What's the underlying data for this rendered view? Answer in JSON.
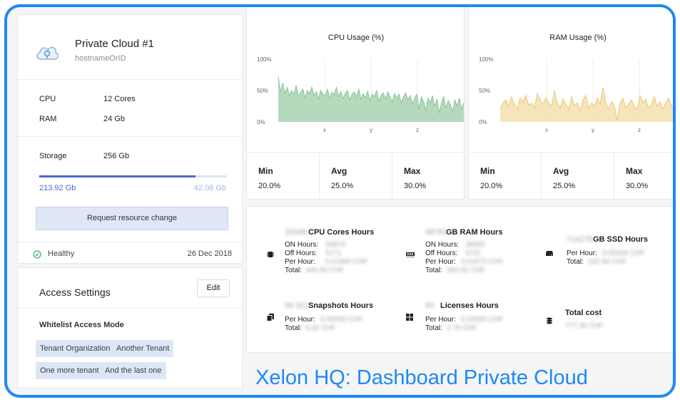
{
  "cloud": {
    "name": "Private Cloud #1",
    "hostname": "hostnameOrID",
    "specs": [
      {
        "label": "CPU",
        "value": "12 Cores"
      },
      {
        "label": "RAM",
        "value": "24 Gb"
      },
      {
        "label": "Storage",
        "value": "256 Gb"
      }
    ],
    "storage_used": "213.92 Gb",
    "storage_free": "42.08 Gb",
    "storage_used_fraction": 0.836,
    "request_button": "Request resource change",
    "status": "Healthy",
    "date": "26 Dec 2018"
  },
  "access": {
    "title": "Access Settings",
    "edit_label": "Edit",
    "mode": "Whitelist Access Mode",
    "tenants": [
      "Tenant Organization",
      "Another Tenant",
      "One more tenant",
      "And the last one"
    ]
  },
  "charts": [
    {
      "title": "CPU Usage (%)",
      "y_ticks": [
        "100%",
        "50%",
        "0%"
      ],
      "x_ticks": [
        "x",
        "y",
        "z"
      ],
      "color": "#a9d2b1",
      "line": "#8cc29a",
      "stats": [
        {
          "label": "Min",
          "value": "20.0%"
        },
        {
          "label": "Avg",
          "value": "25.0%"
        },
        {
          "label": "Max",
          "value": "30.0%"
        }
      ]
    },
    {
      "title": "RAM Usage (%)",
      "y_ticks": [
        "100%",
        "50%",
        "0%"
      ],
      "x_ticks": [
        "x",
        "y",
        "z"
      ],
      "color": "#f5e0ae",
      "line": "#ecc774",
      "stats": [
        {
          "label": "Min",
          "value": "20.0%"
        },
        {
          "label": "Avg",
          "value": "25.0%"
        },
        {
          "label": "Max",
          "value": "30.0%"
        }
      ]
    }
  ],
  "chart_data": [
    {
      "type": "area",
      "title": "CPU Usage (%)",
      "xlabel": "",
      "ylabel": "",
      "ylim": [
        0,
        100
      ],
      "x_ticks": [
        "x",
        "y",
        "z"
      ],
      "values": [
        72,
        48,
        62,
        45,
        55,
        42,
        50,
        44,
        58,
        40,
        47,
        52,
        38,
        50,
        45,
        55,
        42,
        48,
        36,
        50,
        44,
        41,
        52,
        38,
        47,
        43,
        55,
        40,
        48,
        37,
        46,
        50,
        35,
        44,
        48,
        40,
        52,
        36,
        45,
        38,
        49,
        34,
        44,
        40,
        50,
        33,
        42,
        46,
        36,
        48,
        40,
        32,
        45,
        38,
        44,
        30,
        40,
        46,
        35,
        42,
        28,
        38,
        44,
        20,
        40,
        32,
        18,
        38,
        30,
        42,
        24,
        36,
        14,
        30,
        40,
        22,
        34,
        28,
        16,
        35,
        25,
        38,
        20,
        30
      ]
    },
    {
      "type": "area",
      "title": "RAM Usage (%)",
      "xlabel": "",
      "ylabel": "",
      "ylim": [
        0,
        100
      ],
      "x_ticks": [
        "x",
        "y",
        "z"
      ],
      "values": [
        22,
        30,
        35,
        25,
        40,
        28,
        20,
        38,
        32,
        42,
        26,
        30,
        22,
        45,
        35,
        28,
        38,
        30,
        25,
        50,
        30,
        22,
        36,
        28,
        20,
        40,
        26,
        30,
        18,
        35,
        42,
        22,
        30,
        25,
        38,
        28,
        55,
        30,
        20,
        32,
        26,
        2,
        30,
        38,
        22,
        28,
        35,
        24,
        20,
        42,
        30,
        36,
        22,
        28,
        40,
        25,
        32,
        20,
        30,
        38,
        26,
        22,
        34,
        28,
        36,
        40
      ]
    }
  ],
  "usage": [
    {
      "value": "32548",
      "title": "CPU Cores Hours",
      "icon": "chip-icon",
      "rows": [
        {
          "label": "ON Hours:",
          "value": "20873"
        },
        {
          "label": "Off Hours:",
          "value": "5172"
        },
        {
          "label": "Per Hour:",
          "value": "0.01600 CHF"
        },
        {
          "label": "Total:",
          "value": "346.00 CHF"
        }
      ]
    },
    {
      "value": "48781",
      "title": "GB RAM Hours",
      "icon": "ram-icon",
      "rows": [
        {
          "label": "ON Hours:",
          "value": "38082"
        },
        {
          "label": "Off Hours:",
          "value": "9721"
        },
        {
          "label": "Per Hour:",
          "value": "0.01670 CHF"
        },
        {
          "label": "Total:",
          "value": "283.82 CHF"
        }
      ]
    },
    {
      "value": "714276",
      "title": "GB SSD Hours",
      "icon": "disk-icon",
      "rows": [
        {
          "label": "Per Hour:",
          "value": "0.00034 CHF"
        },
        {
          "label": "Total:",
          "value": "242.84 CHF"
        }
      ]
    },
    {
      "value": "56 321",
      "title": "Snapshots Hours",
      "icon": "copy-icon",
      "rows": [
        {
          "label": "Per Hour:",
          "value": "0.00030 CHF"
        },
        {
          "label": "Total:",
          "value": "0.02 CHF"
        }
      ]
    },
    {
      "value": "63",
      "title": "Licenses Hours",
      "icon": "windows-icon",
      "rows": [
        {
          "label": "Per Hour:",
          "value": "0.03000 CHF"
        },
        {
          "label": "Total:",
          "value": "2.79 CHF"
        }
      ]
    },
    {
      "value": "",
      "title": "Total cost",
      "icon": "coins-icon",
      "rows": [
        {
          "label": "",
          "value": "777.36 CHF"
        }
      ]
    }
  ],
  "caption": "Xelon HQ: Dashboard Private Cloud"
}
